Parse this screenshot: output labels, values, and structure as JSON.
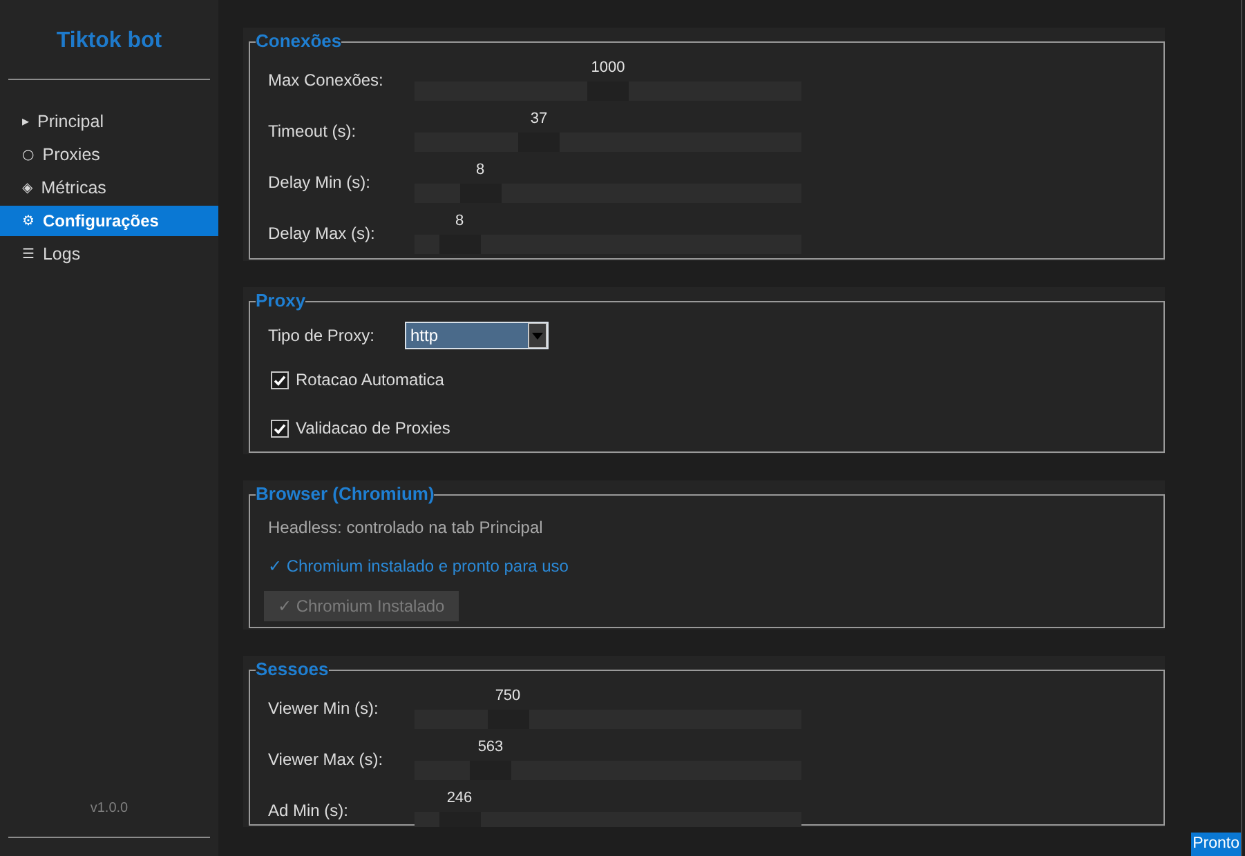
{
  "sidebar": {
    "title": "Tiktok bot",
    "items": [
      {
        "icon": "▸",
        "label": "Principal",
        "selected": false
      },
      {
        "icon": "○",
        "label": "Proxies",
        "selected": false
      },
      {
        "icon": "◈",
        "label": "Métricas",
        "selected": false
      },
      {
        "icon": "⚙",
        "label": "Configurações",
        "selected": true
      },
      {
        "icon": "☰",
        "label": "Logs",
        "selected": false
      }
    ],
    "version": "v1.0.0"
  },
  "sections": [
    {
      "kind": "sliders",
      "title": "Conexões",
      "rows": [
        {
          "label": "Max Conexões:",
          "value": "1000",
          "level": 0.5
        },
        {
          "label": "Timeout (s):",
          "value": "37",
          "level": 0.3
        },
        {
          "label": "Delay Min (s):",
          "value": "8",
          "level": 0.13
        },
        {
          "label": "Delay Max (s):",
          "value": "8",
          "level": 0.07
        }
      ]
    },
    {
      "kind": "proxy",
      "title": "Proxy",
      "dropdown": {
        "label": "Tipo de Proxy:",
        "value": "http",
        "focused": true
      },
      "checkboxes": [
        {
          "label": "Rotacao Automatica",
          "checked": true
        },
        {
          "label": "Validacao de Proxies",
          "checked": true
        }
      ]
    },
    {
      "kind": "browser",
      "title": "Browser (Chromium)",
      "note": "Headless: controlado na tab Principal",
      "status": "✓ Chromium instalado e pronto para uso",
      "button": {
        "label": "✓ Chromium Instalado",
        "disabled": true
      }
    },
    {
      "kind": "sliders",
      "title": "Sessoes",
      "rows": [
        {
          "label": "Viewer Min (s):",
          "value": "750",
          "level": 0.21
        },
        {
          "label": "Viewer Max (s):",
          "value": "563",
          "level": 0.16
        },
        {
          "label": "Ad Min (s):",
          "value": "246",
          "level": 0.07
        }
      ]
    }
  ],
  "status_bar": {
    "text": "Pronto"
  }
}
